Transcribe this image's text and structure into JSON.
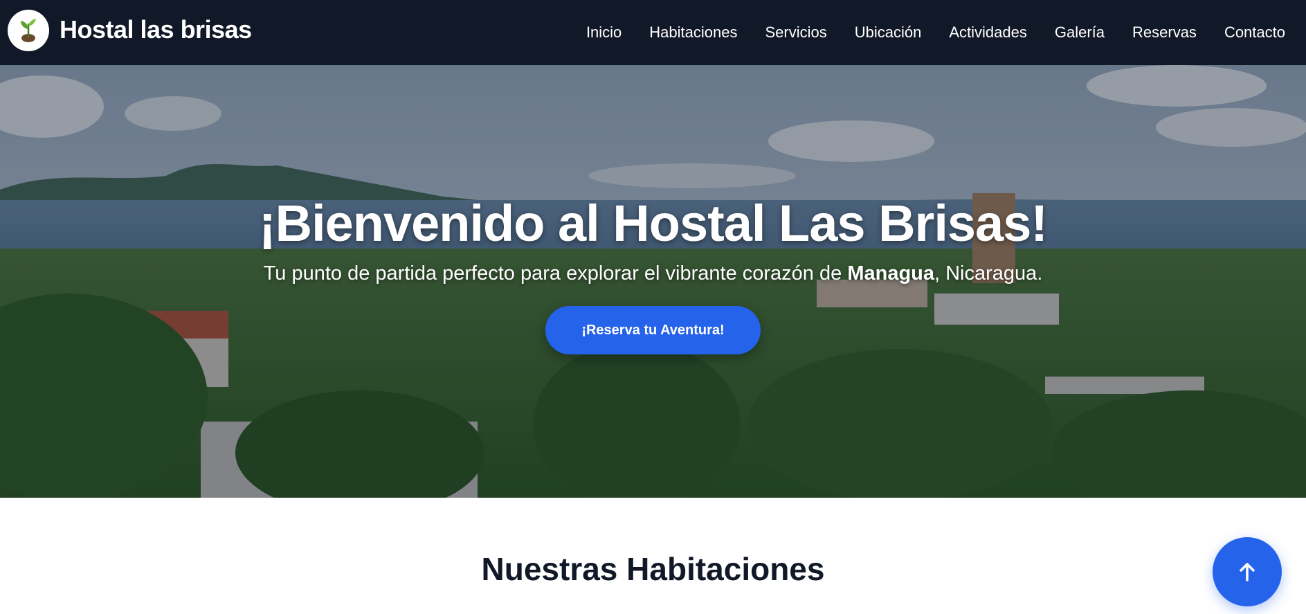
{
  "brand": {
    "name": "Hostal las brisas",
    "logo_icon": "leaf-sprout-icon"
  },
  "nav": {
    "items": [
      {
        "label": "Inicio"
      },
      {
        "label": "Habitaciones"
      },
      {
        "label": "Servicios"
      },
      {
        "label": "Ubicación"
      },
      {
        "label": "Actividades"
      },
      {
        "label": "Galería"
      },
      {
        "label": "Reservas"
      },
      {
        "label": "Contacto"
      }
    ]
  },
  "hero": {
    "title": "¡Bienvenido al Hostal Las Brisas!",
    "subtitle_prefix": "Tu punto de partida perfecto para explorar el vibrante corazón de ",
    "subtitle_bold": "Managua",
    "subtitle_suffix": ", Nicaragua.",
    "cta_label": "¡Reserva tu Aventura!"
  },
  "section": {
    "title": "Nuestras Habitaciones"
  },
  "scroll_top": {
    "icon": "arrow-up-icon"
  },
  "colors": {
    "navbar": "#111827",
    "accent": "#2563eb",
    "text_dark": "#111827"
  }
}
